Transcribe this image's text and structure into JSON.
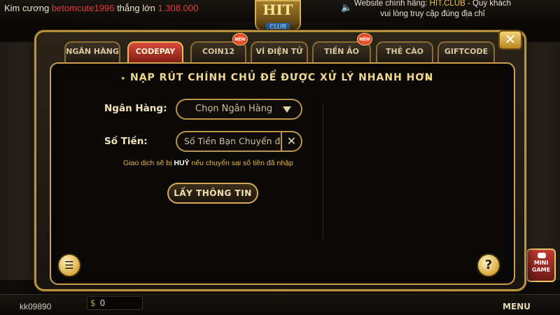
{
  "topbar": {
    "kim_label": "Kim cương",
    "username": "betomcute1996",
    "win_label": "thắng lớn",
    "win_amount": "1.308.000",
    "website_line1_prefix": "Website chính hãng:",
    "website_brand": "HIT.CLUB",
    "website_line1_suffix": "- Quý khách",
    "website_line2": "vui lòng truy cập đúng địa chỉ"
  },
  "logo": {
    "main": "HIT",
    "sub": "CLUB"
  },
  "tabs": [
    {
      "label": "NGÂN HÀNG",
      "active": false,
      "new": false
    },
    {
      "label": "CODEPAY",
      "active": true,
      "new": false
    },
    {
      "label": "COIN12",
      "active": false,
      "new": true
    },
    {
      "label": "VÍ ĐIỆN TỬ",
      "active": false,
      "new": false
    },
    {
      "label": "TIỀN ẢO",
      "active": false,
      "new": true
    },
    {
      "label": "THẺ CÀO",
      "active": false,
      "new": false
    },
    {
      "label": "GIFTCODE",
      "active": false,
      "new": false
    }
  ],
  "new_badge_text": "NEW",
  "heading": "NẠP RÚT CHÍNH CHỦ ĐỂ ĐƯỢC XỬ LÝ NHANH HƠN",
  "form": {
    "bank_label": "Ngân Hàng:",
    "bank_placeholder": "Chọn Ngân Hàng",
    "amount_label": "Số Tiền:",
    "amount_placeholder": "Số Tiền Bạn Chuyển đ",
    "warning_prefix": "Giao dịch sẽ bị",
    "warning_strong": "HUỶ",
    "warning_suffix": "nếu chuyển sai số tiền đã nhập",
    "submit_label": "LẤY THÔNG TIN"
  },
  "bottombar": {
    "username": "kk09890",
    "balance": "0",
    "menu_label": "MENU"
  },
  "minigame": {
    "line1": "MINI",
    "line2": "GAME"
  },
  "icons": [
    "speaker-icon",
    "close-icon",
    "dropdown-caret-icon",
    "clear-icon",
    "note-icon",
    "help-icon",
    "dollar-icon",
    "gamepad-icon"
  ],
  "colors": {
    "gold": "#c9a14c",
    "active_tab": "#d94a3b",
    "warning": "#e3b547",
    "username_red": "#e03b3b"
  }
}
